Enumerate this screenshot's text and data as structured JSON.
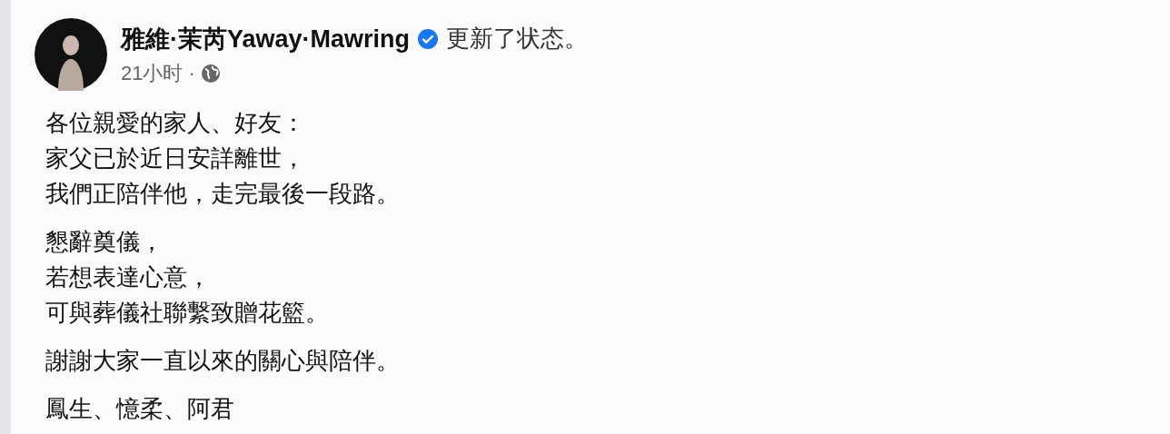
{
  "post": {
    "author": "雅維·茉芮Yaway·Mawring",
    "verified": true,
    "action": "更新了状态。",
    "time": "21小时",
    "separator": "·",
    "public": true,
    "paragraphs": [
      [
        "各位親愛的家人、好友：",
        "家父已於近日安詳離世，",
        "我們正陪伴他，走完最後一段路。"
      ],
      [
        "懇辭奠儀，",
        "若想表達心意，",
        "可與葬儀社聯繫致贈花籃。"
      ],
      [
        "謝謝大家一直以來的關心與陪伴。"
      ],
      [
        "鳳生、憶柔、阿君"
      ]
    ]
  }
}
